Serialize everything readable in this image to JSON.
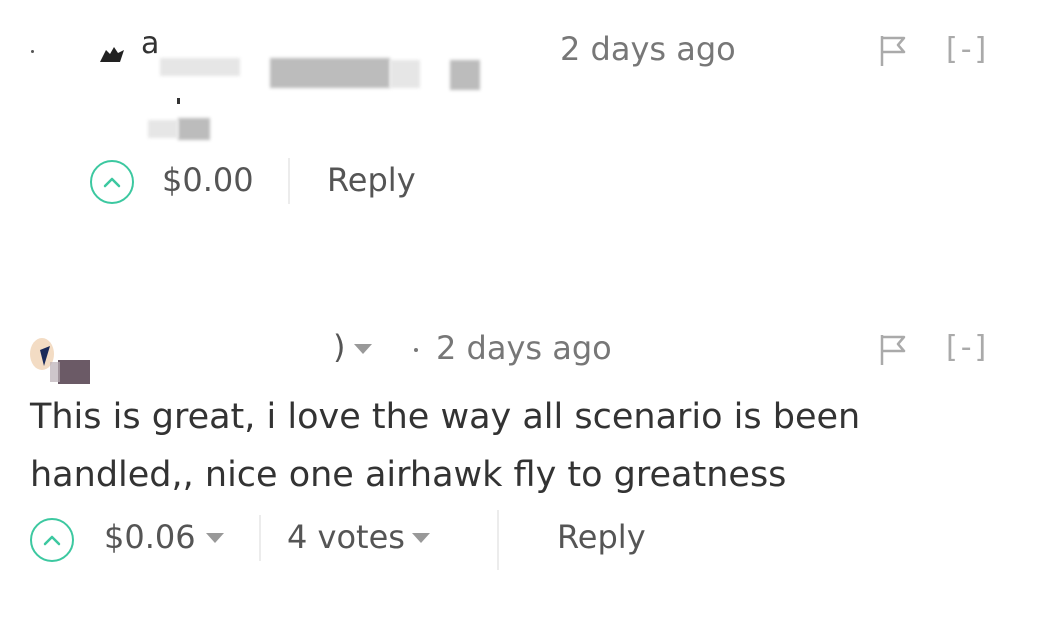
{
  "comments": [
    {
      "author_visible": "a",
      "timestamp": "2 days ago",
      "collapse_label": "[-]",
      "payout": "$0.00",
      "reply_label": "Reply"
    },
    {
      "timestamp": "2 days ago",
      "collapse_label": "[-]",
      "body": "This is great, i love the way all scenario is been handled,, nice one airhawk fly to greatness",
      "payout": "$0.06",
      "votes": "4 votes",
      "reply_label": "Reply"
    }
  ],
  "colors": {
    "upvote_accent": "#3cc8a0",
    "text_primary": "#333333",
    "text_secondary": "#777777",
    "muted": "#aaaaaa"
  },
  "icons": {
    "upvote": "chevron-up-circle-icon",
    "flag": "flag-icon",
    "dropdown": "caret-down-icon"
  }
}
